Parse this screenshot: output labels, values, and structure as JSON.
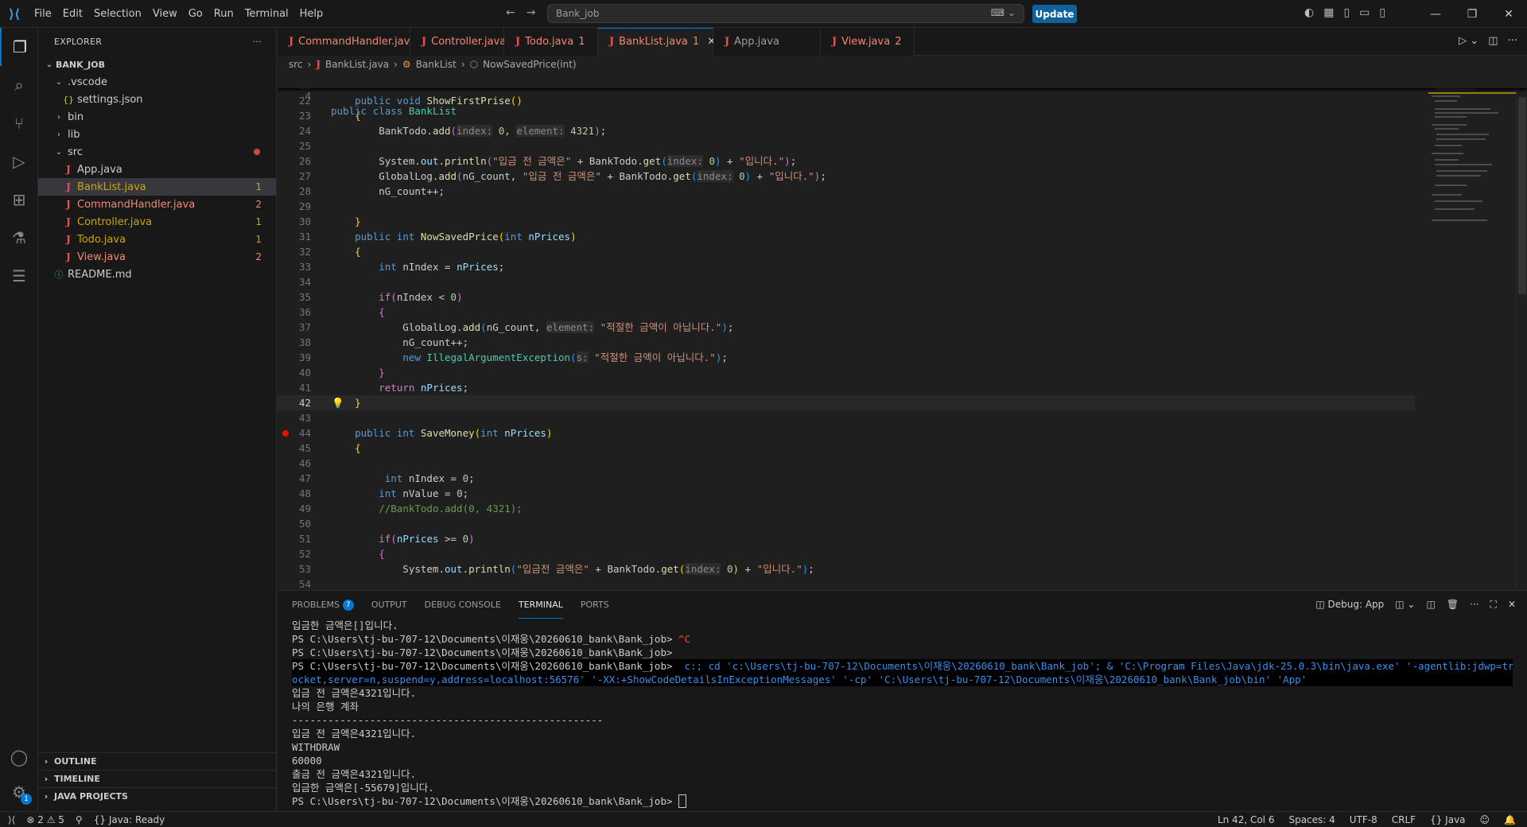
{
  "titlebar": {
    "menu": [
      "File",
      "Edit",
      "Selection",
      "View",
      "Go",
      "Run",
      "Terminal",
      "Help"
    ],
    "search_text": "Bank_job",
    "update_label": "Update"
  },
  "sidebar": {
    "header": "EXPLORER",
    "root": "BANK_JOB",
    "items": [
      {
        "label": ".vscode",
        "kind": "folder-open",
        "indent": 1
      },
      {
        "label": "settings.json",
        "kind": "json",
        "indent": 2
      },
      {
        "label": "bin",
        "kind": "folder",
        "indent": 1
      },
      {
        "label": "lib",
        "kind": "folder",
        "indent": 1
      },
      {
        "label": "src",
        "kind": "folder-open",
        "indent": 1,
        "status": "dot"
      },
      {
        "label": "App.java",
        "kind": "java",
        "indent": 2
      },
      {
        "label": "BankList.java",
        "kind": "java",
        "indent": 2,
        "count": "1",
        "warn": true,
        "selected": true
      },
      {
        "label": "CommandHandler.java",
        "kind": "java",
        "indent": 2,
        "count": "2",
        "err": true
      },
      {
        "label": "Controller.java",
        "kind": "java",
        "indent": 2,
        "count": "1",
        "warn": true
      },
      {
        "label": "Todo.java",
        "kind": "java",
        "indent": 2,
        "count": "1",
        "warn": true
      },
      {
        "label": "View.java",
        "kind": "java",
        "indent": 2,
        "count": "2",
        "err": true
      },
      {
        "label": "README.md",
        "kind": "info",
        "indent": 1
      }
    ],
    "sections": [
      "OUTLINE",
      "TIMELINE",
      "JAVA PROJECTS"
    ]
  },
  "tabs": [
    {
      "label": "CommandHandler.java",
      "count": "2",
      "active": false
    },
    {
      "label": "Controller.java",
      "count": "1",
      "active": false
    },
    {
      "label": "Todo.java",
      "count": "1",
      "active": false
    },
    {
      "label": "BankList.java",
      "count": "1",
      "active": true
    },
    {
      "label": "App.java",
      "count": "",
      "active": false
    },
    {
      "label": "View.java",
      "count": "2",
      "active": false
    }
  ],
  "breadcrumb": [
    "src",
    "BankList.java",
    "BankList",
    "NowSavedPrice(int)"
  ],
  "sticky": {
    "line": "4",
    "text": "public class BankList"
  },
  "code_lines": [
    {
      "n": "21",
      "html": ""
    },
    {
      "n": "22",
      "html": "    <span class='kw'>public</span> <span class='kw'>void</span> <span class='fn'>ShowFirstPrise</span><span class='br1'>()</span>"
    },
    {
      "n": "23",
      "html": "    <span class='br1'>{</span>"
    },
    {
      "n": "24",
      "html": "        BankTodo.<span class='fn'>add</span><span class='br2'>(</span><span class='hint'>index:</span> <span class='nu'>0</span>, <span class='hint'>element:</span> <span class='nu'>4321</span><span class='br2'>)</span>;"
    },
    {
      "n": "25",
      "html": ""
    },
    {
      "n": "26",
      "html": "        System.<span class='pa'>out</span>.<span class='fn'>println</span><span class='br2'>(</span><span class='st'>\"입금 전 금액은\"</span> + BankTodo.<span class='fn'>get</span><span class='br3'>(</span><span class='hint'>index:</span> <span class='nu'>0</span><span class='br3'>)</span> + <span class='st'>\"입니다.\"</span><span class='br2'>)</span>;"
    },
    {
      "n": "27",
      "html": "        GlobalLog.<span class='fn'>add</span><span class='br2'>(</span>nG_count, <span class='st'>\"입금 전 금액은\"</span> + BankTodo.<span class='fn'>get</span><span class='br3'>(</span><span class='hint'>index:</span> <span class='nu'>0</span><span class='br3'>)</span> + <span class='st'>\"입니다.\"</span><span class='br2'>)</span>;"
    },
    {
      "n": "28",
      "html": "        nG_count++;"
    },
    {
      "n": "29",
      "html": ""
    },
    {
      "n": "30",
      "html": "    <span class='br1'>}</span>"
    },
    {
      "n": "31",
      "html": "    <span class='kw'>public</span> <span class='kw'>int</span> <span class='fn'>NowSavedPrice</span><span class='br1'>(</span><span class='kw'>int</span> <span class='pa'>nPrices</span><span class='br1'>)</span>"
    },
    {
      "n": "32",
      "html": "    <span class='br1'>{</span>"
    },
    {
      "n": "33",
      "html": "        <span class='kw'>int</span> nIndex = <span class='pa'>nPrices</span>;"
    },
    {
      "n": "34",
      "html": ""
    },
    {
      "n": "35",
      "html": "        <span class='fl'>if</span><span class='br2'>(</span>nIndex &lt; <span class='nu'>0</span><span class='br2'>)</span>"
    },
    {
      "n": "36",
      "html": "        <span class='br2'>{</span>"
    },
    {
      "n": "37",
      "html": "            GlobalLog.<span class='fn'>add</span><span class='br3'>(</span>nG_count, <span class='hint'>element:</span> <span class='st'>\"적절한 금액이 아닙니다.\"</span><span class='br3'>)</span>;"
    },
    {
      "n": "38",
      "html": "            nG_count++;"
    },
    {
      "n": "39",
      "html": "            <span class='kw'>new</span> <span class='ty'>IllegalArgumentException</span><span class='br3'>(</span><span class='hint'>s:</span> <span class='st'>\"적절한 금액이 아닙니다.\"</span><span class='br3'>)</span>;"
    },
    {
      "n": "40",
      "html": "        <span class='br2'>}</span>"
    },
    {
      "n": "41",
      "html": "        <span class='fl'>return</span> <span class='pa'>nPrices</span>;"
    },
    {
      "n": "42",
      "html": "    <span class='br1'>}</span>",
      "current": true,
      "bulb": true
    },
    {
      "n": "43",
      "html": ""
    },
    {
      "n": "44",
      "html": "    <span class='kw'>public</span> <span class='kw'>int</span> <span class='fn'>SaveMoney</span><span class='br1'>(</span><span class='kw'>int</span> <span class='pa'>nPrices</span><span class='br1'>)</span>",
      "breakpoint": true
    },
    {
      "n": "45",
      "html": "    <span class='br1'>{</span>"
    },
    {
      "n": "46",
      "html": ""
    },
    {
      "n": "47",
      "html": "         <span class='kw'>int</span> nIndex = <span class='nu'>0</span>;"
    },
    {
      "n": "48",
      "html": "        <span class='kw'>int</span> nValue = <span class='nu'>0</span>;"
    },
    {
      "n": "49",
      "html": "        <span class='cm'>//BankTodo.add(0, 4321);</span>"
    },
    {
      "n": "50",
      "html": ""
    },
    {
      "n": "51",
      "html": "        <span class='fl'>if</span><span class='br2'>(</span><span class='pa'>nPrices</span> &gt;= <span class='nu'>0</span><span class='br2'>)</span>"
    },
    {
      "n": "52",
      "html": "        <span class='br2'>{</span>"
    },
    {
      "n": "53",
      "html": "            System.<span class='pa'>out</span>.<span class='fn'>println</span><span class='br3'>(</span><span class='st'>\"입금전 금액은\"</span> + BankTodo.<span class='fn'>get</span><span class='br1'>(</span><span class='hint'>index:</span> <span class='nu'>0</span><span class='br1'>)</span> + <span class='st'>\"입니다.\"</span><span class='br3'>)</span>;"
    },
    {
      "n": "54",
      "html": ""
    }
  ],
  "panel": {
    "tabs": [
      {
        "label": "PROBLEMS",
        "badge": "7"
      },
      {
        "label": "OUTPUT"
      },
      {
        "label": "DEBUG CONSOLE"
      },
      {
        "label": "TERMINAL",
        "active": true
      },
      {
        "label": "PORTS"
      }
    ],
    "debug_label": "Debug: App",
    "terminal_lines": [
      {
        "t": "입금한 금액은[]입니다."
      },
      {
        "t": "PS C:\\Users\\tj-bu-707-12\\Documents\\이재웅\\20260610_bank\\Bank_job> ",
        "extra": "^C",
        "extraClass": "red"
      },
      {
        "t": "PS C:\\Users\\tj-bu-707-12\\Documents\\이재웅\\20260610_bank\\Bank_job> "
      },
      {
        "t": "PS C:\\Users\\tj-bu-707-12\\Documents\\이재웅\\20260610_bank\\Bank_job> ",
        "extra": " c:; cd 'c:\\Users\\tj-bu-707-12\\Documents\\이재웅\\20260610_bank\\Bank_job'; & 'C:\\Program Files\\Java\\jdk-25.0.3\\bin\\java.exe' '-agentlib:jdwp=transport=dt_s",
        "extraClass": "cyan",
        "cmd": true
      },
      {
        "t": "ocket,server=n,suspend=y,address=localhost:56576' '-XX:+ShowCodeDetailsInExceptionMessages' '-cp' 'C:\\Users\\tj-bu-707-12\\Documents\\이재웅\\20260610_bank\\Bank_job\\bin' 'App'",
        "cls": "cyan",
        "cmd": true
      },
      {
        "t": "입금 전 금액은4321입니다."
      },
      {
        "t": "나의 은행 계좌"
      },
      {
        "t": "----------------------------------------------------"
      },
      {
        "t": "입금 전 금액은4321입니다."
      },
      {
        "t": "WITHDRAW"
      },
      {
        "t": "60000"
      },
      {
        "t": "출금 전 금액은4321입니다."
      },
      {
        "t": "입금한 금액은[-55679]입니다."
      },
      {
        "t": "PS C:\\Users\\tj-bu-707-12\\Documents\\이재웅\\20260610_bank\\Bank_job> ",
        "cursor": true
      }
    ]
  },
  "statusbar": {
    "errors": "2",
    "warnings": "5",
    "java_status": "Java: Ready",
    "position": "Ln 42, Col 6",
    "spaces": "Spaces: 4",
    "encoding": "UTF-8",
    "eol": "CRLF",
    "language": "Java"
  },
  "colors": {
    "accent": "#0078d4",
    "error": "#f48771",
    "warning": "#cca700"
  }
}
